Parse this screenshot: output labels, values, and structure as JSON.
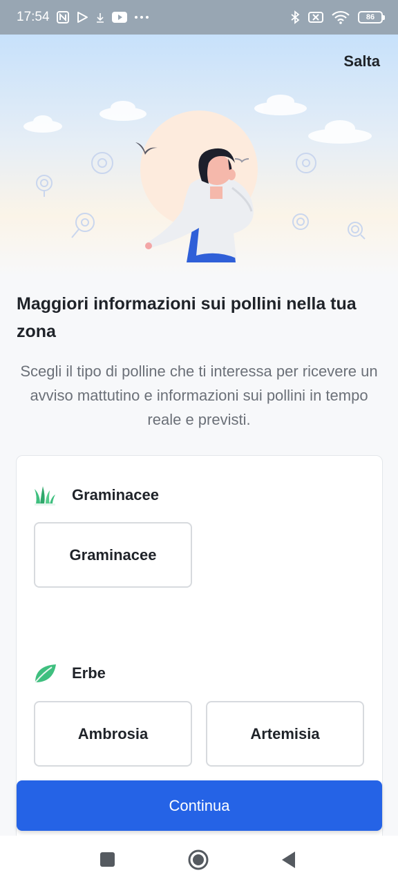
{
  "status_bar": {
    "time": "17:54",
    "battery": "86",
    "icons": [
      "nfc-icon",
      "play-store-icon",
      "download-icon",
      "youtube-icon",
      "more-dots-icon",
      "bluetooth-icon",
      "mute-icon",
      "wifi-icon",
      "battery-icon"
    ]
  },
  "hero": {
    "skip_label": "Salta"
  },
  "heading": "Maggiori informazioni sui pollini nella tua zona",
  "subtitle": "Scegli il tipo di polline che ti interessa per ricevere un avviso mattutino e informazioni sui pollini in tempo reale e previsti.",
  "categories": [
    {
      "title": "Graminacee",
      "icon": "grass-icon",
      "options": [
        "Graminacee"
      ]
    },
    {
      "title": "Erbe",
      "icon": "leaf-icon",
      "options": [
        "Ambrosia",
        "Artemisia"
      ]
    }
  ],
  "continue_label": "Continua",
  "colors": {
    "primary": "#2563e6",
    "status_bar": "#98a6b3",
    "grass": "#3fbf7f"
  },
  "nav_bar": {
    "icons": [
      "recents-square-icon",
      "home-circle-icon",
      "back-triangle-icon"
    ]
  }
}
